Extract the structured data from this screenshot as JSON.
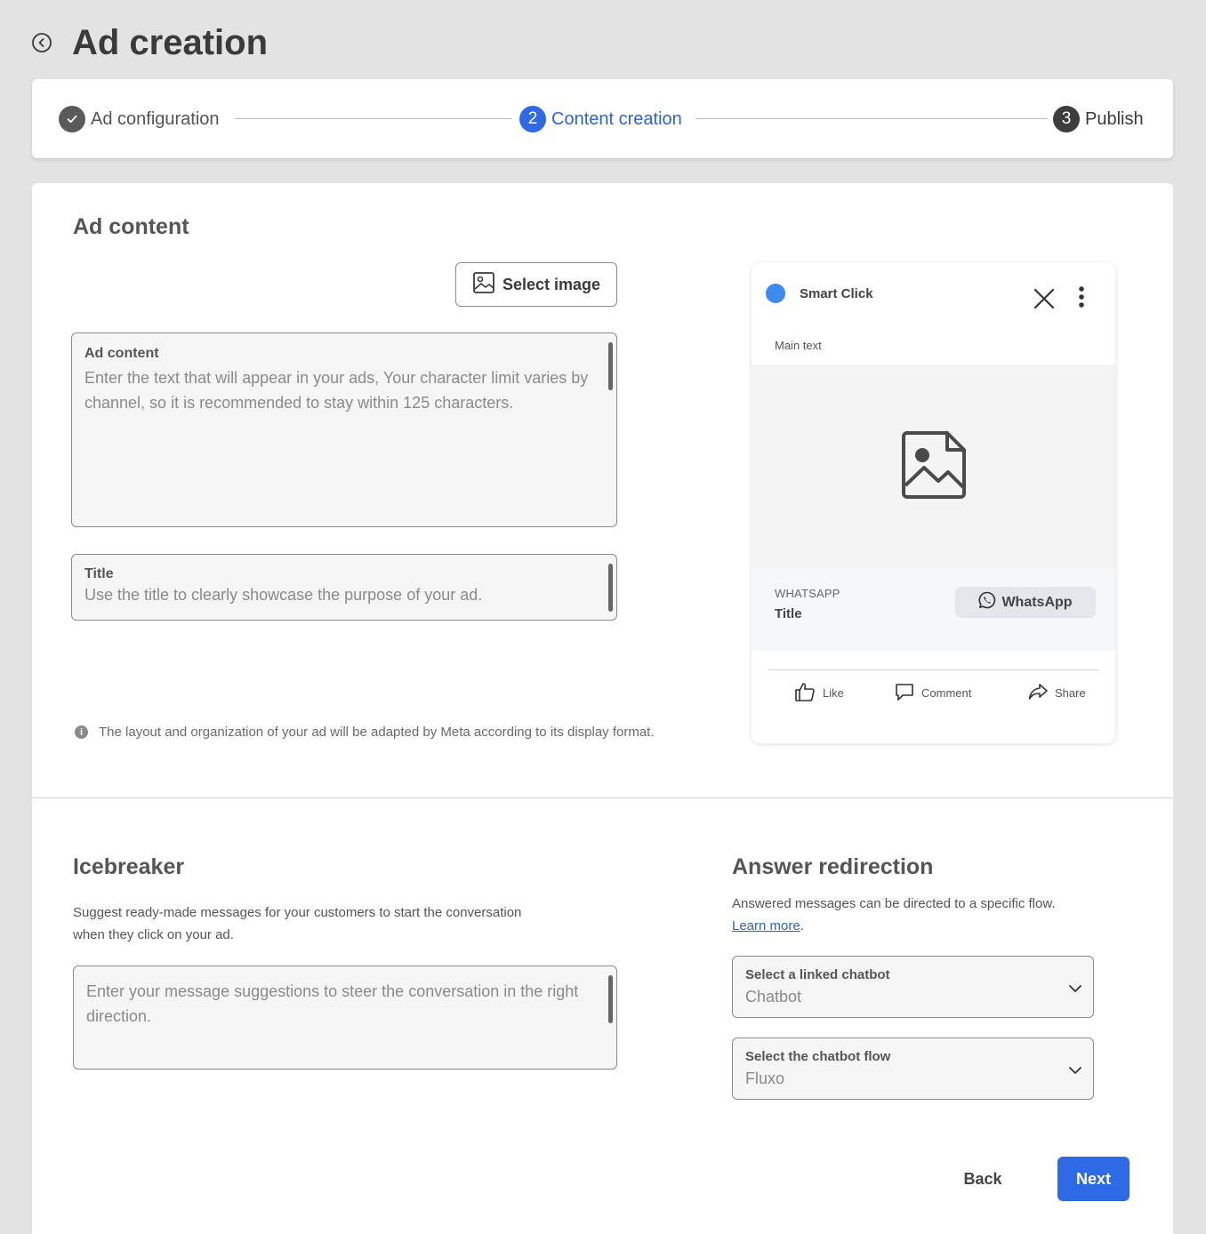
{
  "header": {
    "title": "Ad creation"
  },
  "stepper": {
    "steps": [
      {
        "label": "Ad configuration",
        "status": "done"
      },
      {
        "number": "2",
        "label": "Content creation",
        "status": "current"
      },
      {
        "number": "3",
        "label": "Publish",
        "status": "upcoming"
      }
    ]
  },
  "ad_content": {
    "heading": "Ad content",
    "select_image_label": "Select image",
    "content_field": {
      "label": "Ad content",
      "value": "",
      "placeholder": "Enter the text that will appear in your ads, Your character limit varies by channel, so it is recommended to stay within 125 characters."
    },
    "title_field": {
      "label": "Title",
      "value": "",
      "placeholder": "Use the title to clearly showcase the purpose of your ad."
    },
    "note": "The layout and organization of your ad will be adapted by Meta according to its display format."
  },
  "preview": {
    "brand": "Smart Click",
    "main_text": "Main text",
    "channel": "WHATSAPP",
    "title": "Title",
    "cta": "WhatsApp",
    "reactions": {
      "like": "Like",
      "comment": "Comment",
      "share": "Share"
    }
  },
  "icebreaker": {
    "heading": "Icebreaker",
    "description_line1": "Suggest ready-made messages for your customers to start the conversation",
    "description_line2": "when they click on your ad.",
    "field": {
      "value": "",
      "placeholder": "Enter your message suggestions to steer the conversation in the right direction."
    }
  },
  "redirection": {
    "heading": "Answer redirection",
    "description": "Answered messages can be directed to a specific flow.",
    "learn_more": "Learn more",
    "chatbot_select": {
      "label": "Select a linked chatbot",
      "value": "Chatbot"
    },
    "flow_select": {
      "label": "Select the chatbot flow",
      "value": "Fluxo"
    }
  },
  "actions": {
    "back": "Back",
    "next": "Next"
  },
  "colors": {
    "primary": "#2f6ae6",
    "brand_dot": "#3c8cf0",
    "background": "#e3e3e3"
  }
}
